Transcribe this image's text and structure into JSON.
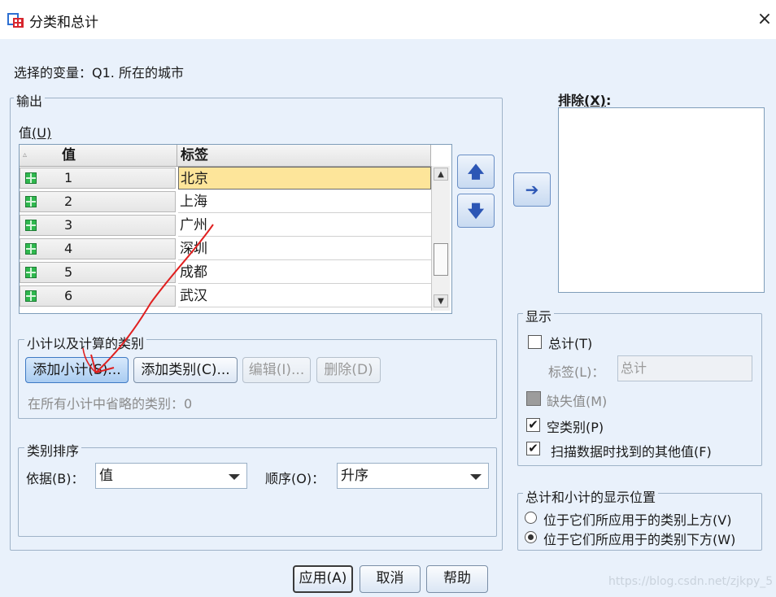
{
  "window": {
    "title": "分类和总计",
    "close_icon": "×"
  },
  "selected_variable": {
    "label": "选择的变量：Q1. 所在的城市"
  },
  "output": {
    "legend": "输出",
    "values_label": "值",
    "values_key": "(U)",
    "columns": {
      "value": "值",
      "label": "标签"
    },
    "rows": [
      {
        "value": "1",
        "label": "北京"
      },
      {
        "value": "2",
        "label": "上海"
      },
      {
        "value": "3",
        "label": "广州"
      },
      {
        "value": "4",
        "label": "深圳"
      },
      {
        "value": "5",
        "label": "成都"
      },
      {
        "value": "6",
        "label": "武汉"
      }
    ]
  },
  "arrows": {
    "up": "🡅",
    "down": "🡇",
    "exclude": "➔"
  },
  "exclude": {
    "label": "排除",
    "key": "(X)",
    "colon": ":"
  },
  "subtotals": {
    "legend": "小计以及计算的类别",
    "add_subtotal": "添加小计(S)...",
    "add_category": "添加类别(C)...",
    "edit": "编辑(I)...",
    "delete": "删除(D)",
    "omitted_text": "在所有小计中省略的类别：0"
  },
  "sort": {
    "legend": "类别排序",
    "by_label": "依据(B)：",
    "by_value": "值",
    "order_label": "顺序(O)：",
    "order_value": "升序"
  },
  "display": {
    "legend": "显示",
    "total_label": "总计(T)",
    "total_checked": false,
    "label_label": "标签(L)：",
    "label_value": "总计",
    "missing_label": "缺失值(M)",
    "missing_state": "indeterminate",
    "empty_label": "空类别(P)",
    "empty_checked": true,
    "other_label": "扫描数据时找到的其他值(F)",
    "other_checked": true,
    "check_mark": "✔"
  },
  "position": {
    "legend": "总计和小计的显示位置",
    "above": "位于它们所应用于的类别上方(V)",
    "below": "位于它们所应用于的类别下方(W)",
    "selected": "below"
  },
  "footer": {
    "apply": "应用(A)",
    "cancel": "取消",
    "help": "帮助"
  },
  "watermark": "https://blog.csdn.net/zjkpy_5",
  "colors": {
    "selected_row": "#fde59a",
    "arrow_blue": "#2c56b5",
    "background": "#e9f1fb"
  }
}
